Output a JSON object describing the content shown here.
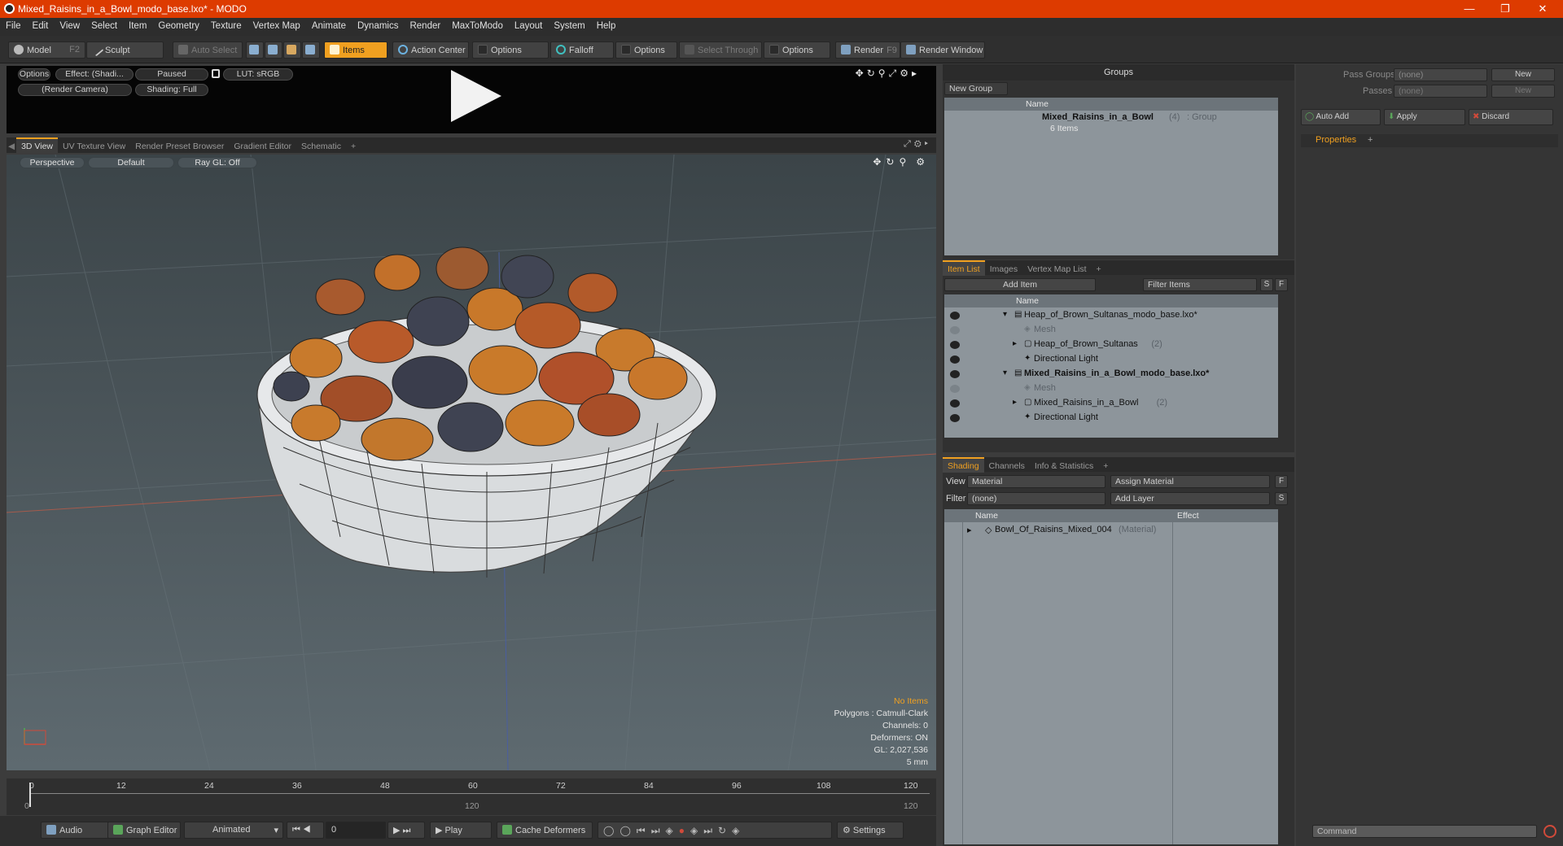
{
  "window": {
    "title": "Mixed_Raisins_in_a_Bowl_modo_base.lxo* - MODO"
  },
  "menu": [
    "File",
    "Edit",
    "View",
    "Select",
    "Item",
    "Geometry",
    "Texture",
    "Vertex Map",
    "Animate",
    "Dynamics",
    "Render",
    "MaxToModo",
    "Layout",
    "System",
    "Help"
  ],
  "toolbar": {
    "model": "Model",
    "model_key": "F2",
    "sculpt": "Sculpt",
    "auto_select": "Auto Select",
    "items": "Items",
    "action_center": "Action Center",
    "options1": "Options",
    "falloff": "Falloff",
    "options2": "Options",
    "select_through": "Select Through",
    "options3": "Options",
    "render": "Render",
    "render_key": "F9",
    "render_window": "Render Window"
  },
  "preview": {
    "options": "Options",
    "effect": "Effect: (Shadi...",
    "paused": "Paused",
    "lut": "LUT: sRGB",
    "camera": "(Render Camera)",
    "shading": "Shading: Full"
  },
  "viewport_tabs": [
    "3D View",
    "UV Texture View",
    "Render Preset Browser",
    "Gradient Editor",
    "Schematic",
    "+"
  ],
  "viewport": {
    "perspective": "Perspective",
    "default": "Default",
    "raygl": "Ray GL: Off"
  },
  "stats": {
    "no_items": "No Items",
    "polygons": "Polygons : Catmull-Clark",
    "channels": "Channels: 0",
    "deformers": "Deformers: ON",
    "gl": "GL: 2,027,536",
    "unit": "5 mm"
  },
  "timeline": {
    "ticks": [
      "0",
      "12",
      "24",
      "36",
      "48",
      "60",
      "72",
      "84",
      "96",
      "108",
      "120"
    ],
    "sub_ticks": [
      "0",
      "120",
      "120"
    ]
  },
  "bottombar": {
    "audio": "Audio",
    "graph_editor": "Graph Editor",
    "animated": "Animated",
    "frame": "0",
    "play": "Play",
    "cache_deformers": "Cache Deformers",
    "settings": "Settings"
  },
  "groups": {
    "title": "Groups",
    "new_group": "New Group",
    "col_name": "Name",
    "group_name": "Mixed_Raisins_in_a_Bowl",
    "group_count": "(4)",
    "group_type": ": Group",
    "group_items": "6 Items"
  },
  "pass": {
    "pass_groups": "Pass Groups",
    "passes": "Passes",
    "none1": "(none)",
    "none2": "(none)",
    "new1": "New",
    "new2": "New",
    "auto_add": "Auto Add",
    "apply": "Apply",
    "discard": "Discard",
    "properties": "Properties",
    "plus": "+",
    "command_placeholder": "Command"
  },
  "itemlist": {
    "tabs": [
      "Item List",
      "Images",
      "Vertex Map List",
      "+"
    ],
    "add_item": "Add Item",
    "filter": "Filter Items",
    "s": "S",
    "f": "F",
    "col_name": "Name",
    "rows": [
      {
        "label": "Heap_of_Brown_Sultanas_modo_base.lxo*",
        "indent": 0,
        "kind": "scene",
        "bold": false,
        "count": ""
      },
      {
        "label": "Mesh",
        "indent": 1,
        "kind": "mesh",
        "bold": false,
        "count": ""
      },
      {
        "label": "Heap_of_Brown_Sultanas",
        "indent": 1,
        "kind": "group",
        "bold": false,
        "count": "(2)"
      },
      {
        "label": "Directional Light",
        "indent": 1,
        "kind": "light",
        "bold": false,
        "count": ""
      },
      {
        "label": "Mixed_Raisins_in_a_Bowl_modo_base.lxo*",
        "indent": 0,
        "kind": "scene",
        "bold": true,
        "count": ""
      },
      {
        "label": "Mesh",
        "indent": 1,
        "kind": "mesh",
        "bold": false,
        "count": ""
      },
      {
        "label": "Mixed_Raisins_in_a_Bowl",
        "indent": 1,
        "kind": "group",
        "bold": false,
        "count": "(2)"
      },
      {
        "label": "Directional Light",
        "indent": 1,
        "kind": "light",
        "bold": false,
        "count": ""
      }
    ]
  },
  "shading": {
    "tabs": [
      "Shading",
      "Channels",
      "Info & Statistics",
      "+"
    ],
    "view_label": "View",
    "view_value": "Material",
    "assign_material": "Assign Material",
    "f": "F",
    "filter_label": "Filter",
    "filter_value": "(none)",
    "add_layer": "Add Layer",
    "s": "S",
    "col_name": "Name",
    "col_effect": "Effect",
    "material_name": "Bowl_Of_Raisins_Mixed_004",
    "material_type": "(Material)"
  },
  "colors": {
    "accent": "#f0a020",
    "titlebar": "#dd3b00"
  }
}
